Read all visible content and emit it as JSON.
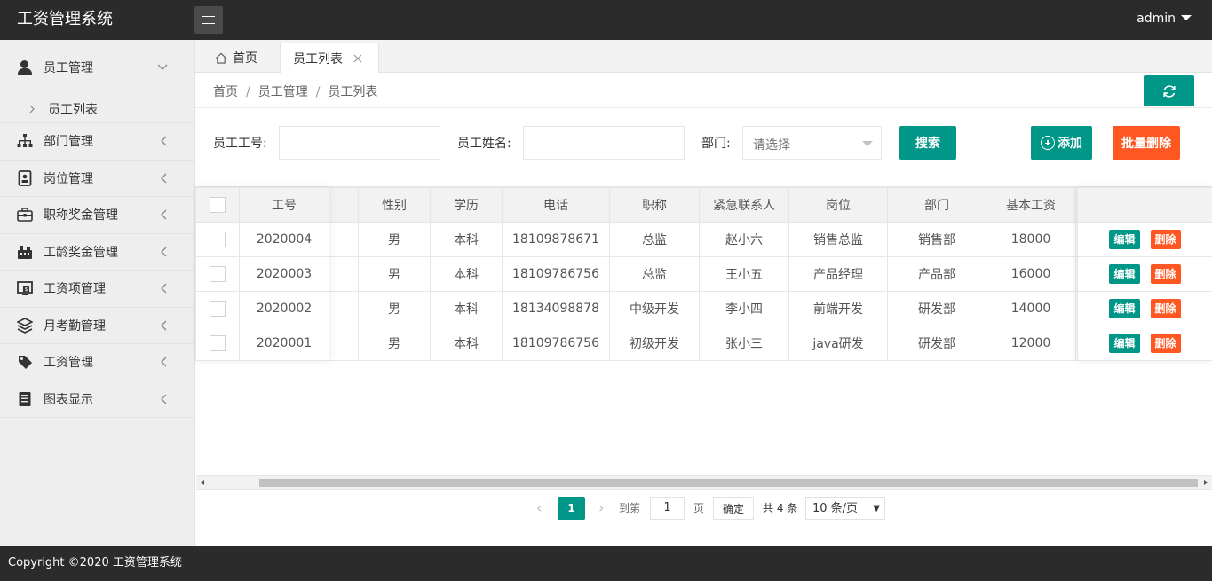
{
  "app": {
    "title": "工资管理系统",
    "user": "admin"
  },
  "sidebar": {
    "items": [
      {
        "label": "员工管理",
        "icon": "user-icon",
        "expanded": true,
        "sub": [
          {
            "label": "员工列表"
          }
        ]
      },
      {
        "label": "部门管理",
        "icon": "sitemap-icon"
      },
      {
        "label": "岗位管理",
        "icon": "badge-icon"
      },
      {
        "label": "职称奖金管理",
        "icon": "briefcase-icon"
      },
      {
        "label": "工龄奖金管理",
        "icon": "chart-icon"
      },
      {
        "label": "工资项管理",
        "icon": "monitor-icon"
      },
      {
        "label": "月考勤管理",
        "icon": "layers-icon"
      },
      {
        "label": "工资管理",
        "icon": "tag-icon"
      },
      {
        "label": "图表显示",
        "icon": "document-icon"
      }
    ]
  },
  "tabs": [
    {
      "label": "首页"
    },
    {
      "label": "员工列表",
      "active": true
    }
  ],
  "breadcrumb": [
    "首页",
    "员工管理",
    "员工列表"
  ],
  "search": {
    "emp_no_label": "员工工号:",
    "emp_name_label": "员工姓名:",
    "dept_label": "部门:",
    "dept_placeholder": "请选择",
    "search_button": "搜索",
    "add_button": "添加",
    "batch_delete_button": "批量删除"
  },
  "table": {
    "columns": [
      "工号",
      "性别",
      "学历",
      "电话",
      "职称",
      "紧急联系人",
      "岗位",
      "部门",
      "基本工资"
    ],
    "rows": [
      {
        "id": "2020004",
        "gender": "男",
        "edu": "本科",
        "phone": "18109878671",
        "title": "总监",
        "contact": "赵小六",
        "post": "销售总监",
        "dept": "销售部",
        "salary": "18000"
      },
      {
        "id": "2020003",
        "gender": "男",
        "edu": "本科",
        "phone": "18109786756",
        "title": "总监",
        "contact": "王小五",
        "post": "产品经理",
        "dept": "产品部",
        "salary": "16000"
      },
      {
        "id": "2020002",
        "gender": "男",
        "edu": "本科",
        "phone": "18134098878",
        "title": "中级开发",
        "contact": "李小四",
        "post": "前端开发",
        "dept": "研发部",
        "salary": "14000"
      },
      {
        "id": "2020001",
        "gender": "男",
        "edu": "本科",
        "phone": "18109786756",
        "title": "初级开发",
        "contact": "张小三",
        "post": "java研发",
        "dept": "研发部",
        "salary": "12000"
      }
    ],
    "edit_label": "编辑",
    "delete_label": "删除"
  },
  "pagination": {
    "current": "1",
    "goto_label": "到第",
    "goto_value": "1",
    "page_unit": "页",
    "confirm": "确定",
    "total": "共 4 条",
    "page_size": "10 条/页"
  },
  "footer": {
    "copyright": "Copyright ©2020 工资管理系统"
  },
  "colors": {
    "primary": "#009688",
    "danger": "#ff5722",
    "header": "#2b2b2b"
  }
}
